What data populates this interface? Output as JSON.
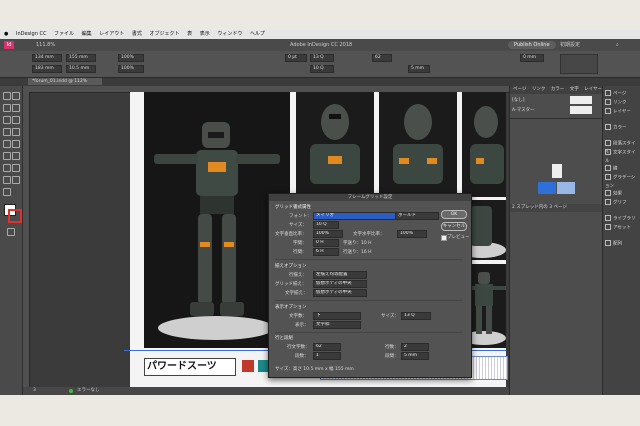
{
  "menubar": {
    "items": [
      "InDesign CC",
      "ファイル",
      "編集",
      "レイアウト",
      "書式",
      "オブジェクト",
      "表",
      "表示",
      "ウィンドウ",
      "ヘルプ"
    ]
  },
  "appbar": {
    "title": "Adobe InDesign CC 2018",
    "zoom": "111.8%",
    "publish_label": "Publish Online",
    "workspace": "初期設定"
  },
  "control": {
    "x": "134 mm",
    "y": "183 mm",
    "w": "155 mm",
    "h": "10.5 mm",
    "pct1": "100%",
    "pct2": "100%",
    "pt": "0 pt",
    "size": "13 Q",
    "size2": "10 Q",
    "lines": "62",
    "mm1": "5 mm",
    "zero_mm": "0 mm"
  },
  "doc_tab": "*forum_01.indd @ 112%",
  "page": {
    "headline": "パワードスーツ"
  },
  "dialog": {
    "title": "フレームグリッド設定",
    "sec_grid": "グリッド書式属性",
    "font_label": "フォント：",
    "font_value": "メイリオ",
    "font_style": "ボールド",
    "size_label": "サイズ：",
    "size_value": "10 Q",
    "vscale_label": "文字垂直比率：",
    "vscale_value": "100%",
    "hscale_label": "文字水平比率：",
    "hscale_value": "100%",
    "char_space_label": "字間：",
    "char_space_value": "0 H",
    "char_space_note": "字送り：10 H",
    "line_space_label": "行間：",
    "line_space_value": "6 H",
    "line_space_note": "行送り：16 H",
    "sec_align": "揃えオプション",
    "line_align_label": "行揃え：",
    "line_align_value": "左揃え均等配置",
    "grid_align_label": "グリッド揃え：",
    "grid_align_value": "仮想ボディの中央",
    "char_align_label": "文字揃え：",
    "char_align_value": "仮想ボディの中央",
    "sec_view": "表示オプション",
    "count_label": "文字数：",
    "count_value": "下",
    "count_size_label": "サイズ：",
    "count_size_value": "13 Q",
    "display_label": "表示：",
    "display_value": "文字枠",
    "sec_lines": "行と段組",
    "cols_label": "行文字数：",
    "cols_value": "62",
    "rows_label": "行数：",
    "rows_value": "2",
    "col_count_label": "段数：",
    "col_count_value": "1",
    "gutter_label": "段間：",
    "gutter_value": "5 mm",
    "summary": "サイズ：高さ 10.5 mm x 幅 155 mm",
    "ok": "OK",
    "cancel": "キャンセル",
    "preview": "プレビュー"
  },
  "panels": {
    "tabs": [
      "ページ",
      "リンク",
      "カラー",
      "文字",
      "レイヤー"
    ],
    "none_label": "[なし]",
    "master_label": "A-マスター",
    "spread_info": "2 スプレッド内の 3 ページ",
    "icon_items": [
      "ページ",
      "リンク",
      "レイヤー",
      "カラー",
      "段落スタイル",
      "文字スタイル",
      "線",
      "グラデーション",
      "効果",
      "グリフ",
      "ライブラリ",
      "アセット",
      "配列"
    ]
  },
  "status": {
    "page": "3",
    "state": "エラーなし"
  }
}
